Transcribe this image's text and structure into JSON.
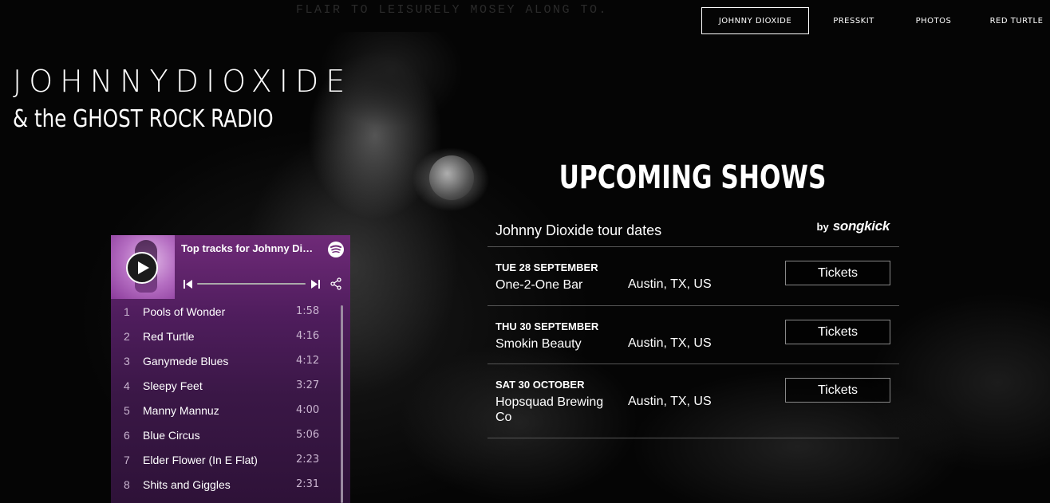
{
  "tagline": "FLAIR TO LEISURELY MOSEY ALONG TO.",
  "nav": {
    "items": [
      {
        "label": "JOHNNY DIOXIDE",
        "active": true
      },
      {
        "label": "PRESSKIT",
        "active": false
      },
      {
        "label": "PHOTOS",
        "active": false
      },
      {
        "label": "RED TURTLE",
        "active": false
      }
    ]
  },
  "brand": {
    "title": "JOHNNYDIOXIDE",
    "subtitle": "& the GHOST ROCK RADIO"
  },
  "shows": {
    "heading": "UPCOMING SHOWS",
    "panel_title": "Johnny Dioxide tour dates",
    "by_label": "by",
    "provider": "songkick",
    "items": [
      {
        "date": "TUE 28 SEPTEMBER",
        "venue": "One-2-One Bar",
        "location": "Austin, TX, US",
        "button": "Tickets"
      },
      {
        "date": "THU 30 SEPTEMBER",
        "venue": "Smokin Beauty",
        "location": "Austin, TX, US",
        "button": "Tickets"
      },
      {
        "date": "SAT 30 OCTOBER",
        "venue": "Hopsquad Brewing Co",
        "location": "Austin, TX, US",
        "button": "Tickets"
      }
    ]
  },
  "player": {
    "title": "Top tracks for Johnny Dioxide",
    "icons": {
      "play": "play-icon",
      "logo": "spotify-icon",
      "prev": "skip-previous-icon",
      "next": "skip-next-icon",
      "share": "share-icon"
    },
    "tracks": [
      {
        "num": "1",
        "name": "Pools of Wonder",
        "duration": "1:58"
      },
      {
        "num": "2",
        "name": "Red Turtle",
        "duration": "4:16"
      },
      {
        "num": "3",
        "name": "Ganymede Blues",
        "duration": "4:12"
      },
      {
        "num": "4",
        "name": "Sleepy Feet",
        "duration": "3:27"
      },
      {
        "num": "5",
        "name": "Manny Mannuz",
        "duration": "4:00"
      },
      {
        "num": "6",
        "name": "Blue Circus",
        "duration": "5:06"
      },
      {
        "num": "7",
        "name": "Elder Flower (In E Flat)",
        "duration": "2:23"
      },
      {
        "num": "8",
        "name": "Shits and Giggles",
        "duration": "2:31"
      }
    ]
  },
  "colors": {
    "background": "#000000",
    "player_purple": "#6f2a78",
    "text": "#ffffff"
  }
}
